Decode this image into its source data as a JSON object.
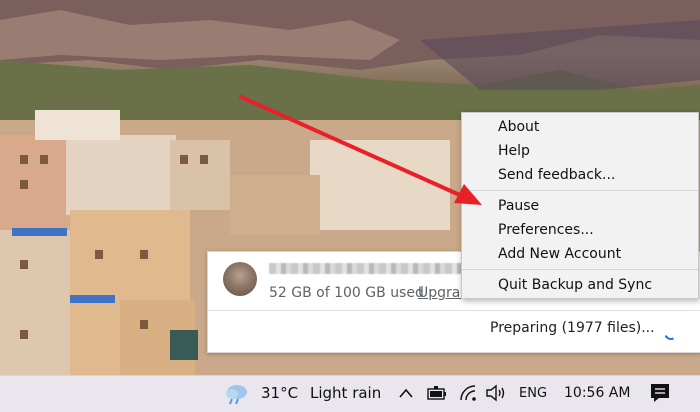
{
  "menu": {
    "items": [
      {
        "label": "About"
      },
      {
        "label": "Help"
      },
      {
        "label": "Send feedback..."
      },
      {
        "label": "Pause"
      },
      {
        "label": "Preferences..."
      },
      {
        "label": "Add New Account"
      },
      {
        "label": "Quit Backup and Sync"
      }
    ]
  },
  "panel": {
    "storage_text": "52 GB of 100 GB used",
    "upgrade_label": "Upgrade",
    "status_text": "Preparing (1977 files)..."
  },
  "taskbar": {
    "temperature": "31°C",
    "weather": "Light rain",
    "language": "ENG",
    "time": "10:56 AM"
  },
  "icons": [
    "weather-cloud-rain-icon",
    "chevron-up-icon",
    "battery-icon",
    "wifi-icon",
    "volume-icon",
    "notifications-icon",
    "spinner-icon",
    "red-arrow-annotation"
  ],
  "colors": {
    "arrow": "#e8202a",
    "menu_bg": "#f2f2f2",
    "taskbar_bg": "#e9e6ee",
    "spinner": "#1a73e8"
  }
}
